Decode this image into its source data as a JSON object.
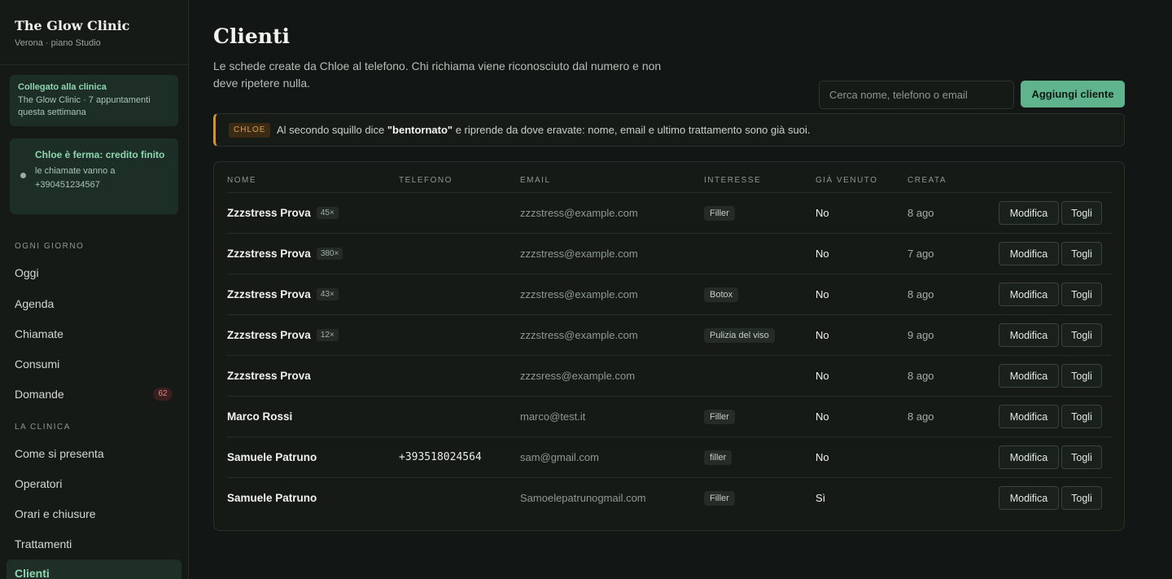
{
  "sidebar": {
    "brand_title": "The Glow Clinic",
    "brand_subtitle": "Verona · piano Studio",
    "connected_title": "Collegato alla clinica",
    "connected_text": "The Glow Clinic · 7 appuntamenti questa settimana",
    "warning_title": "Chloe è ferma: credito finito",
    "warning_text": "le chiamate vanno a +390451234567",
    "section_daily": "OGNI GIORNO",
    "section_clinic": "LA CLINICA",
    "items": [
      {
        "label": "Oggi"
      },
      {
        "label": "Agenda"
      },
      {
        "label": "Chiamate"
      },
      {
        "label": "Consumi"
      },
      {
        "label": "Domande",
        "badge": "62"
      },
      {
        "label": "Come si presenta"
      },
      {
        "label": "Operatori"
      },
      {
        "label": "Orari e chiusure"
      },
      {
        "label": "Trattamenti"
      },
      {
        "label": "Clienti"
      }
    ]
  },
  "main": {
    "title": "Clienti",
    "description": "Le schede create da Chloe al telefono. Chi richiama viene riconosciuto dal numero e non deve ripetere nulla.",
    "search_placeholder": "Cerca nome, telefono o email",
    "add_button": "Aggiungi cliente",
    "notice": {
      "tag": "CHLOE",
      "before": "Al secondo squillo dice ",
      "bold": "\"bentornato\"",
      "after": " e riprende da dove eravate: nome, email e ultimo trattamento sono già suoi."
    },
    "columns": [
      "NOME",
      "TELEFONO",
      "EMAIL",
      "INTERESSE",
      "GIÀ VENUTO",
      "CREATA"
    ],
    "edit_label": "Modifica",
    "remove_label": "Togli",
    "rows": [
      {
        "name": "Zzzstress Prova",
        "count": "45×",
        "phone": "",
        "email": "zzzstress@example.com",
        "interest": "Filler",
        "came": "No",
        "created": "8 ago"
      },
      {
        "name": "Zzzstress Prova",
        "count": "380×",
        "phone": "",
        "email": "zzzstress@example.com",
        "interest": "",
        "came": "No",
        "created": "7 ago"
      },
      {
        "name": "Zzzstress Prova",
        "count": "43×",
        "phone": "",
        "email": "zzzstress@example.com",
        "interest": "Botox",
        "came": "No",
        "created": "8 ago"
      },
      {
        "name": "Zzzstress Prova",
        "count": "12×",
        "phone": "",
        "email": "zzzstress@example.com",
        "interest": "Pulizia del viso",
        "came": "No",
        "created": "9 ago"
      },
      {
        "name": "Zzzstress Prova",
        "count": "",
        "phone": "",
        "email": "zzzsress@example.com",
        "interest": "",
        "came": "No",
        "created": "8 ago"
      },
      {
        "name": "Marco Rossi",
        "count": "",
        "phone": "",
        "email": "marco@test.it",
        "interest": "Filler",
        "came": "No",
        "created": "8 ago"
      },
      {
        "name": "Samuele Patruno",
        "count": "",
        "phone": "+393518024564",
        "email": "sam@gmail.com",
        "interest": "filler",
        "came": "No",
        "created": ""
      },
      {
        "name": "Samuele Patruno",
        "count": "",
        "phone": "",
        "email": "Samoelepatrunogmail.com",
        "interest": "Filler",
        "came": "Sì",
        "created": ""
      }
    ]
  }
}
